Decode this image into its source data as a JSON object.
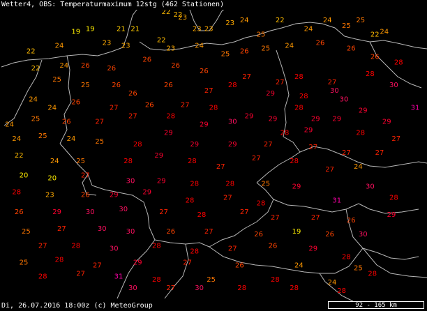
{
  "header": {
    "title": "Wetter4, OBS: Temperaturmaximum 12stg (462 Stationen)"
  },
  "footer": {
    "status": "Di, 26.07.2016 18:00z (c) MeteoGroup",
    "scale": "92 - 165 km"
  },
  "colors": {
    "background": "#000000",
    "border_line": "#b8b8b8",
    "t19": "#ffee00",
    "t20": "#ffee00",
    "t21": "#ffcc00",
    "t22": "#ffbb00",
    "t23": "#ffaa00",
    "t24": "#ff9900",
    "t25": "#ff7700",
    "t26": "#ff4400",
    "t27": "#ff2200",
    "t28": "#ff0000",
    "t29": "#ff0030",
    "t30": "#ff1060",
    "t31": "#ff00aa"
  },
  "stations": [
    {
      "v": 19,
      "lon": 6.0,
      "lat": 54.2
    },
    {
      "v": 19,
      "lon": 6.6,
      "lat": 54.3
    },
    {
      "v": 21,
      "lon": 7.9,
      "lat": 54.3
    },
    {
      "v": 21,
      "lon": 8.5,
      "lat": 54.3
    },
    {
      "v": 22,
      "lon": 9.8,
      "lat": 54.9
    },
    {
      "v": 22,
      "lon": 10.3,
      "lat": 54.8
    },
    {
      "v": 23,
      "lon": 10.5,
      "lat": 54.7
    },
    {
      "v": 23,
      "lon": 11.1,
      "lat": 54.3
    },
    {
      "v": 23,
      "lon": 11.6,
      "lat": 54.3
    },
    {
      "v": 23,
      "lon": 12.5,
      "lat": 54.5
    },
    {
      "v": 24,
      "lon": 13.1,
      "lat": 54.6
    },
    {
      "v": 25,
      "lon": 13.8,
      "lat": 54.1
    },
    {
      "v": 22,
      "lon": 14.6,
      "lat": 54.6
    },
    {
      "v": 24,
      "lon": 15.8,
      "lat": 54.3
    },
    {
      "v": 24,
      "lon": 16.6,
      "lat": 54.6
    },
    {
      "v": 25,
      "lon": 17.4,
      "lat": 54.4
    },
    {
      "v": 25,
      "lon": 18.0,
      "lat": 54.6
    },
    {
      "v": 22,
      "lon": 18.6,
      "lat": 54.1
    },
    {
      "v": 24,
      "lon": 19.0,
      "lat": 54.2
    },
    {
      "v": 22,
      "lon": 4.1,
      "lat": 53.5
    },
    {
      "v": 24,
      "lon": 5.3,
      "lat": 53.7
    },
    {
      "v": 23,
      "lon": 7.3,
      "lat": 53.8
    },
    {
      "v": 23,
      "lon": 8.1,
      "lat": 53.7
    },
    {
      "v": 22,
      "lon": 9.6,
      "lat": 53.9
    },
    {
      "v": 23,
      "lon": 10.0,
      "lat": 53.6
    },
    {
      "v": 24,
      "lon": 11.2,
      "lat": 53.7
    },
    {
      "v": 25,
      "lon": 12.3,
      "lat": 53.4
    },
    {
      "v": 26,
      "lon": 13.1,
      "lat": 53.5
    },
    {
      "v": 25,
      "lon": 14.0,
      "lat": 53.6
    },
    {
      "v": 24,
      "lon": 15.0,
      "lat": 53.7
    },
    {
      "v": 26,
      "lon": 16.3,
      "lat": 53.8
    },
    {
      "v": 26,
      "lon": 17.6,
      "lat": 53.6
    },
    {
      "v": 26,
      "lon": 18.6,
      "lat": 53.3
    },
    {
      "v": 28,
      "lon": 19.6,
      "lat": 53.1
    },
    {
      "v": 22,
      "lon": 4.3,
      "lat": 52.9
    },
    {
      "v": 24,
      "lon": 5.5,
      "lat": 53.0
    },
    {
      "v": 26,
      "lon": 6.4,
      "lat": 53.0
    },
    {
      "v": 26,
      "lon": 7.5,
      "lat": 52.9
    },
    {
      "v": 26,
      "lon": 9.0,
      "lat": 53.2
    },
    {
      "v": 26,
      "lon": 10.2,
      "lat": 53.0
    },
    {
      "v": 26,
      "lon": 11.4,
      "lat": 52.8
    },
    {
      "v": 27,
      "lon": 13.2,
      "lat": 52.6
    },
    {
      "v": 27,
      "lon": 14.6,
      "lat": 52.4
    },
    {
      "v": 28,
      "lon": 15.4,
      "lat": 52.6
    },
    {
      "v": 27,
      "lon": 16.8,
      "lat": 52.4
    },
    {
      "v": 28,
      "lon": 18.4,
      "lat": 52.7
    },
    {
      "v": 30,
      "lon": 19.4,
      "lat": 52.3
    },
    {
      "v": 25,
      "lon": 5.2,
      "lat": 52.5
    },
    {
      "v": 25,
      "lon": 6.4,
      "lat": 52.3
    },
    {
      "v": 26,
      "lon": 7.7,
      "lat": 52.3
    },
    {
      "v": 26,
      "lon": 8.4,
      "lat": 52.0
    },
    {
      "v": 26,
      "lon": 9.9,
      "lat": 52.3
    },
    {
      "v": 27,
      "lon": 11.6,
      "lat": 52.1
    },
    {
      "v": 28,
      "lon": 12.6,
      "lat": 52.3
    },
    {
      "v": 29,
      "lon": 14.2,
      "lat": 52.0
    },
    {
      "v": 28,
      "lon": 15.6,
      "lat": 51.9
    },
    {
      "v": 30,
      "lon": 16.9,
      "lat": 52.1
    },
    {
      "v": 30,
      "lon": 17.3,
      "lat": 51.8
    },
    {
      "v": 29,
      "lon": 18.1,
      "lat": 51.4
    },
    {
      "v": 31,
      "lon": 20.3,
      "lat": 51.5
    },
    {
      "v": 24,
      "lon": 4.2,
      "lat": 51.8
    },
    {
      "v": 24,
      "lon": 5.0,
      "lat": 51.5
    },
    {
      "v": 26,
      "lon": 6.0,
      "lat": 51.7
    },
    {
      "v": 27,
      "lon": 7.6,
      "lat": 51.5
    },
    {
      "v": 26,
      "lon": 9.1,
      "lat": 51.6
    },
    {
      "v": 27,
      "lon": 10.6,
      "lat": 51.6
    },
    {
      "v": 28,
      "lon": 11.8,
      "lat": 51.5
    },
    {
      "v": 29,
      "lon": 13.3,
      "lat": 51.2
    },
    {
      "v": 29,
      "lon": 14.3,
      "lat": 51.1
    },
    {
      "v": 28,
      "lon": 15.4,
      "lat": 51.5
    },
    {
      "v": 29,
      "lon": 16.1,
      "lat": 51.1
    },
    {
      "v": 29,
      "lon": 17.0,
      "lat": 51.1
    },
    {
      "v": 29,
      "lon": 19.1,
      "lat": 51.0
    },
    {
      "v": 24,
      "lon": 3.2,
      "lat": 50.9
    },
    {
      "v": 25,
      "lon": 4.3,
      "lat": 51.1
    },
    {
      "v": 26,
      "lon": 5.6,
      "lat": 51.0
    },
    {
      "v": 27,
      "lon": 7.0,
      "lat": 51.0
    },
    {
      "v": 27,
      "lon": 8.4,
      "lat": 51.2
    },
    {
      "v": 28,
      "lon": 10.0,
      "lat": 51.2
    },
    {
      "v": 29,
      "lon": 11.4,
      "lat": 50.9
    },
    {
      "v": 30,
      "lon": 12.6,
      "lat": 51.0
    },
    {
      "v": 28,
      "lon": 14.8,
      "lat": 50.6
    },
    {
      "v": 29,
      "lon": 15.8,
      "lat": 50.7
    },
    {
      "v": 28,
      "lon": 18.0,
      "lat": 50.6
    },
    {
      "v": 27,
      "lon": 19.5,
      "lat": 50.4
    },
    {
      "v": 24,
      "lon": 3.5,
      "lat": 50.4
    },
    {
      "v": 25,
      "lon": 4.6,
      "lat": 50.5
    },
    {
      "v": 24,
      "lon": 5.8,
      "lat": 50.4
    },
    {
      "v": 25,
      "lon": 7.0,
      "lat": 50.3
    },
    {
      "v": 28,
      "lon": 8.6,
      "lat": 50.2
    },
    {
      "v": 29,
      "lon": 9.9,
      "lat": 50.6
    },
    {
      "v": 29,
      "lon": 11.0,
      "lat": 50.2
    },
    {
      "v": 29,
      "lon": 12.6,
      "lat": 50.2
    },
    {
      "v": 27,
      "lon": 14.1,
      "lat": 50.2
    },
    {
      "v": 27,
      "lon": 16.0,
      "lat": 50.1
    },
    {
      "v": 27,
      "lon": 17.4,
      "lat": 49.9
    },
    {
      "v": 27,
      "lon": 18.8,
      "lat": 49.9
    },
    {
      "v": 22,
      "lon": 3.6,
      "lat": 49.8
    },
    {
      "v": 24,
      "lon": 5.1,
      "lat": 49.6
    },
    {
      "v": 25,
      "lon": 6.2,
      "lat": 49.6
    },
    {
      "v": 28,
      "lon": 8.2,
      "lat": 49.6
    },
    {
      "v": 29,
      "lon": 9.5,
      "lat": 49.8
    },
    {
      "v": 28,
      "lon": 10.9,
      "lat": 49.6
    },
    {
      "v": 27,
      "lon": 12.1,
      "lat": 49.4
    },
    {
      "v": 27,
      "lon": 13.6,
      "lat": 49.7
    },
    {
      "v": 28,
      "lon": 15.2,
      "lat": 49.6
    },
    {
      "v": 27,
      "lon": 16.7,
      "lat": 49.3
    },
    {
      "v": 24,
      "lon": 17.9,
      "lat": 49.4
    },
    {
      "v": 20,
      "lon": 3.8,
      "lat": 49.1
    },
    {
      "v": 20,
      "lon": 5.0,
      "lat": 49.0
    },
    {
      "v": 27,
      "lon": 6.4,
      "lat": 49.1
    },
    {
      "v": 30,
      "lon": 8.3,
      "lat": 48.9
    },
    {
      "v": 29,
      "lon": 9.6,
      "lat": 48.9
    },
    {
      "v": 28,
      "lon": 11.0,
      "lat": 48.8
    },
    {
      "v": 28,
      "lon": 12.5,
      "lat": 48.8
    },
    {
      "v": 25,
      "lon": 14.0,
      "lat": 48.8
    },
    {
      "v": 29,
      "lon": 15.3,
      "lat": 48.7
    },
    {
      "v": 30,
      "lon": 18.4,
      "lat": 48.7
    },
    {
      "v": 28,
      "lon": 3.5,
      "lat": 48.5
    },
    {
      "v": 23,
      "lon": 4.9,
      "lat": 48.4
    },
    {
      "v": 26,
      "lon": 6.4,
      "lat": 48.4
    },
    {
      "v": 29,
      "lon": 7.6,
      "lat": 48.4
    },
    {
      "v": 29,
      "lon": 9.0,
      "lat": 48.5
    },
    {
      "v": 28,
      "lon": 10.8,
      "lat": 48.2
    },
    {
      "v": 27,
      "lon": 12.4,
      "lat": 48.3
    },
    {
      "v": 28,
      "lon": 13.8,
      "lat": 48.1
    },
    {
      "v": 31,
      "lon": 17.0,
      "lat": 48.2
    },
    {
      "v": 28,
      "lon": 19.4,
      "lat": 48.3
    },
    {
      "v": 26,
      "lon": 3.6,
      "lat": 47.8
    },
    {
      "v": 29,
      "lon": 5.2,
      "lat": 47.8
    },
    {
      "v": 30,
      "lon": 6.6,
      "lat": 47.8
    },
    {
      "v": 30,
      "lon": 8.0,
      "lat": 47.9
    },
    {
      "v": 27,
      "lon": 9.7,
      "lat": 47.8
    },
    {
      "v": 28,
      "lon": 11.3,
      "lat": 47.7
    },
    {
      "v": 27,
      "lon": 13.1,
      "lat": 47.8
    },
    {
      "v": 27,
      "lon": 14.4,
      "lat": 47.6
    },
    {
      "v": 27,
      "lon": 16.1,
      "lat": 47.6
    },
    {
      "v": 26,
      "lon": 17.6,
      "lat": 47.5
    },
    {
      "v": 29,
      "lon": 19.3,
      "lat": 47.7
    },
    {
      "v": 25,
      "lon": 3.9,
      "lat": 47.1
    },
    {
      "v": 27,
      "lon": 5.4,
      "lat": 47.2
    },
    {
      "v": 30,
      "lon": 7.1,
      "lat": 47.2
    },
    {
      "v": 30,
      "lon": 8.3,
      "lat": 47.1
    },
    {
      "v": 26,
      "lon": 10.0,
      "lat": 47.1
    },
    {
      "v": 27,
      "lon": 11.6,
      "lat": 47.1
    },
    {
      "v": 26,
      "lon": 13.7,
      "lat": 47.0
    },
    {
      "v": 19,
      "lon": 15.3,
      "lat": 47.1
    },
    {
      "v": 26,
      "lon": 16.7,
      "lat": 47.0
    },
    {
      "v": 30,
      "lon": 18.1,
      "lat": 47.0
    },
    {
      "v": 27,
      "lon": 4.6,
      "lat": 46.6
    },
    {
      "v": 28,
      "lon": 6.0,
      "lat": 46.6
    },
    {
      "v": 30,
      "lon": 7.6,
      "lat": 46.5
    },
    {
      "v": 28,
      "lon": 9.4,
      "lat": 46.6
    },
    {
      "v": 28,
      "lon": 11.0,
      "lat": 46.4
    },
    {
      "v": 27,
      "lon": 12.6,
      "lat": 46.5
    },
    {
      "v": 26,
      "lon": 14.3,
      "lat": 46.6
    },
    {
      "v": 29,
      "lon": 16.0,
      "lat": 46.5
    },
    {
      "v": 28,
      "lon": 17.4,
      "lat": 46.2
    },
    {
      "v": 25,
      "lon": 3.8,
      "lat": 46.0
    },
    {
      "v": 28,
      "lon": 5.3,
      "lat": 46.1
    },
    {
      "v": 27,
      "lon": 6.9,
      "lat": 45.9
    },
    {
      "v": 29,
      "lon": 8.6,
      "lat": 46.0
    },
    {
      "v": 27,
      "lon": 10.7,
      "lat": 46.0
    },
    {
      "v": 26,
      "lon": 12.9,
      "lat": 45.9
    },
    {
      "v": 24,
      "lon": 15.4,
      "lat": 45.9
    },
    {
      "v": 25,
      "lon": 17.9,
      "lat": 45.8
    },
    {
      "v": 28,
      "lon": 4.6,
      "lat": 45.5
    },
    {
      "v": 27,
      "lon": 6.2,
      "lat": 45.6
    },
    {
      "v": 31,
      "lon": 7.8,
      "lat": 45.5
    },
    {
      "v": 28,
      "lon": 9.4,
      "lat": 45.4
    },
    {
      "v": 25,
      "lon": 11.7,
      "lat": 45.4
    },
    {
      "v": 28,
      "lon": 14.4,
      "lat": 45.4
    },
    {
      "v": 24,
      "lon": 16.8,
      "lat": 45.3
    },
    {
      "v": 28,
      "lon": 18.5,
      "lat": 45.6
    },
    {
      "v": 30,
      "lon": 8.4,
      "lat": 45.1
    },
    {
      "v": 27,
      "lon": 10.0,
      "lat": 45.1
    },
    {
      "v": 30,
      "lon": 11.2,
      "lat": 45.1
    },
    {
      "v": 28,
      "lon": 13.0,
      "lat": 45.1
    },
    {
      "v": 28,
      "lon": 15.2,
      "lat": 45.1
    },
    {
      "v": 28,
      "lon": 17.2,
      "lat": 45.0
    }
  ]
}
